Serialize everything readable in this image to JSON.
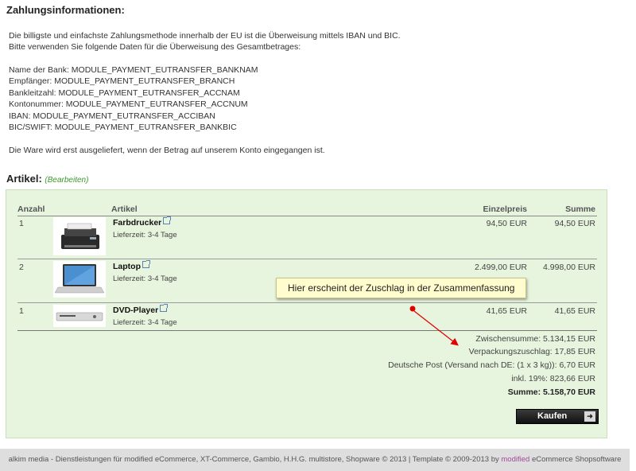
{
  "payment": {
    "title": "Zahlungsinformationen:",
    "intro1": "Die billigste und einfachste Zahlungsmethode innerhalb der EU ist die Überweisung mittels IBAN und BIC.",
    "intro2": "Bitte verwenden Sie folgende Daten für die Überweisung des Gesamtbetrages:",
    "bank_name": "Name der Bank: MODULE_PAYMENT_EUTRANSFER_BANKNAM",
    "recipient": "Empfänger: MODULE_PAYMENT_EUTRANSFER_BRANCH",
    "blz": "Bankleitzahl: MODULE_PAYMENT_EUTRANSFER_ACCNAM",
    "account": "Kontonummer: MODULE_PAYMENT_EUTRANSFER_ACCNUM",
    "iban": "IBAN: MODULE_PAYMENT_EUTRANSFER_ACCIBAN",
    "bic": "BIC/SWIFT: MODULE_PAYMENT_EUTRANSFER_BANKBIC",
    "note": "Die Ware wird erst ausgeliefert, wenn der Betrag auf unserem Konto eingegangen ist."
  },
  "articles": {
    "title": "Artikel:",
    "edit_link": "(Bearbeiten)",
    "columns": {
      "qty": "Anzahl",
      "article": "Artikel",
      "unit_price": "Einzelpreis",
      "total": "Summe"
    },
    "rows": [
      {
        "qty": "1",
        "name": "Farbdrucker",
        "delivery": "Lieferzeit: 3-4 Tage",
        "unit_price": "94,50 EUR",
        "total": "94,50 EUR"
      },
      {
        "qty": "2",
        "name": "Laptop",
        "delivery": "Lieferzeit: 3-4 Tage",
        "unit_price": "2.499,00 EUR",
        "total": "4.998,00 EUR"
      },
      {
        "qty": "1",
        "name": "DVD-Player",
        "delivery": "Lieferzeit: 3-4 Tage",
        "unit_price": "41,65 EUR",
        "total": "41,65 EUR"
      }
    ],
    "summary": {
      "subtotal": "Zwischensumme: 5.134,15 EUR",
      "packaging": "Verpackungszuschlag:     17,85 EUR",
      "shipping": "Deutsche Post (Versand nach DE: (1 x 3 kg)):      6,70 EUR",
      "tax": "inkl. 19%:    823,66 EUR",
      "sum": "Summe:  5.158,70 EUR"
    },
    "buy_label": "Kaufen",
    "buy_arrow": "➜"
  },
  "tooltip": "Hier erscheint der Zuschlag in der Zusammenfassung",
  "footer": {
    "pre": "alkim media - Dienstleistungen für modified eCommerce, XT-Commerce, Gambio, H.H.G. multistore, Shopware © 2013 | Template © 2009-2013 by ",
    "brand": "modified",
    "post": " eCommerce Shopsoftware"
  },
  "colors": {
    "panel_bg": "#e7f4de",
    "edit_link": "#3a9a2a",
    "tooltip_bg": "#fffccd",
    "arrow": "#e00000"
  }
}
